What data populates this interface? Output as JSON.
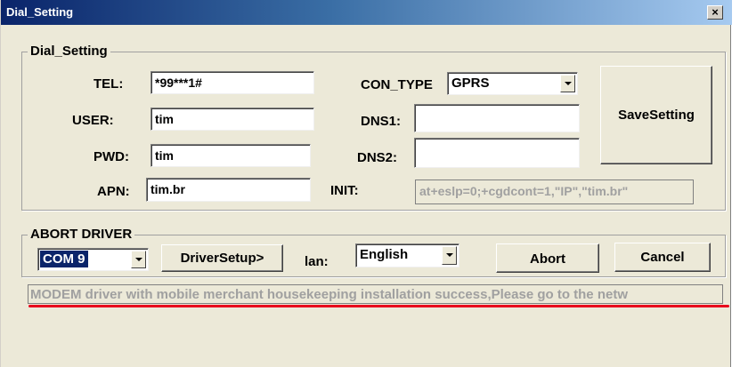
{
  "window": {
    "title": "Dial_Setting",
    "close_label": "×"
  },
  "dial": {
    "legend": "Dial_Setting",
    "tel_label": "TEL:",
    "tel_value": "*99***1#",
    "user_label": "USER:",
    "user_value": "tim",
    "pwd_label": "PWD:",
    "pwd_value": "tim",
    "apn_label": "APN:",
    "apn_value": "tim.br",
    "contype_label": "CON_TYPE",
    "contype_value": "GPRS",
    "dns1_label": "DNS1:",
    "dns1_value": "",
    "dns2_label": "DNS2:",
    "dns2_value": "",
    "init_label": "INIT:",
    "init_value": "at+eslp=0;+cgdcont=1,\"IP\",\"tim.br\"",
    "save_label": "SaveSetting"
  },
  "abort": {
    "legend": "ABORT DRIVER",
    "com_value": "COM 9",
    "driver_setup_label": "DriverSetup>",
    "lan_label": "lan:",
    "lan_value": "English",
    "abort_label": "Abort",
    "cancel_label": "Cancel"
  },
  "status": {
    "message": "MODEM driver with mobile merchant housekeeping  installation success,Please go to the netw"
  },
  "colors": {
    "title_gradient_start": "#0a246a",
    "dialog_bg": "#ece9d8",
    "annotation_red": "#e8001c"
  },
  "icons": {
    "close": "close-icon",
    "dropdown": "chevron-down-icon"
  }
}
